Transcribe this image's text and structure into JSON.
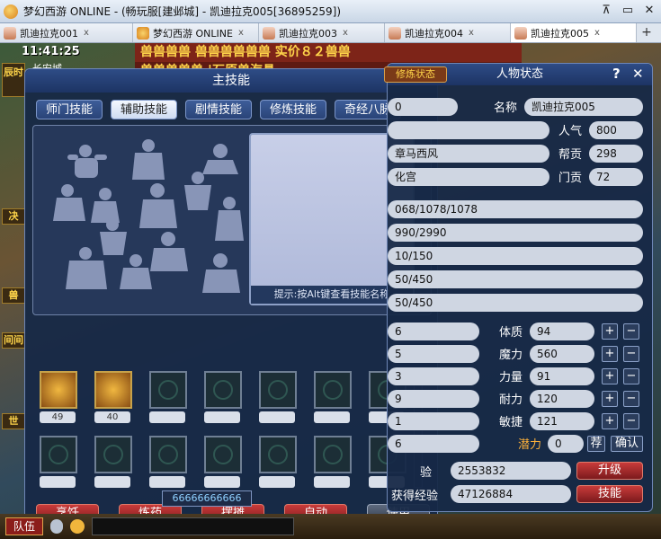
{
  "window": {
    "title": "梦幻西游 ONLINE - (畅玩服[建邺城] - 凯迪拉克005[36895259])",
    "minimize": "▭",
    "pin": "⊼",
    "close": "✕"
  },
  "tabs": [
    {
      "label": "凯迪拉克001"
    },
    {
      "label": "梦幻西游 ONLINE"
    },
    {
      "label": "凯迪拉克003"
    },
    {
      "label": "凯迪拉克004"
    },
    {
      "label": "凯迪拉克005",
      "active": true
    }
  ],
  "tab_add": "+",
  "tab_close": "x",
  "hud": {
    "clock": "11:41:25",
    "city": "长安城",
    "banner_row1": "兽兽兽兽  兽兽兽兽兽兽  实价８２兽兽",
    "banner_row2": "兽兽兽兽兽  |石原兽海悬",
    "side_icons": [
      "辰时",
      "决",
      "兽",
      "间间",
      "世"
    ],
    "team_label": "队伍",
    "number_field": "66666666666"
  },
  "main_panel": {
    "title": "主技能",
    "help": "?",
    "close": "✕",
    "tabs": [
      "师门技能",
      "辅助技能",
      "剧情技能",
      "修炼技能",
      "奇经八脉"
    ],
    "active_tab": "辅助技能",
    "hint": "提示:按Alt键查看技能名称",
    "slots_row1": [
      {
        "filled": true,
        "level": "49"
      },
      {
        "filled": true,
        "level": "40"
      },
      {
        "filled": false,
        "level": ""
      },
      {
        "filled": false,
        "level": ""
      },
      {
        "filled": false,
        "level": ""
      },
      {
        "filled": false,
        "level": ""
      },
      {
        "filled": false,
        "level": ""
      }
    ],
    "slots_row2": [
      {
        "filled": false,
        "level": ""
      },
      {
        "filled": false,
        "level": ""
      },
      {
        "filled": false,
        "level": ""
      },
      {
        "filled": false,
        "level": ""
      },
      {
        "filled": false,
        "level": ""
      },
      {
        "filled": false,
        "level": ""
      },
      {
        "filled": false,
        "level": ""
      }
    ],
    "buttons": [
      "烹饪",
      "炼药",
      "摆摊",
      "自动"
    ],
    "use_button": "使用"
  },
  "status_panel": {
    "title": "人物状态",
    "help": "?",
    "close": "✕",
    "tab_label": "修炼状态",
    "level_value": "0",
    "name_label": "名称",
    "name_value": "凯迪拉克005",
    "popularity_label": "人气",
    "popularity_value": "800",
    "row2_value": "",
    "gang_label": "帮贡",
    "gang_value": "298",
    "title_value": "章马西风",
    "sect_label": "门贡",
    "sect_value": "72",
    "sect_name": "化宫",
    "hp": "068/1078/1078",
    "mp": "990/2990",
    "anger": "10/150",
    "vitality": "50/450",
    "energy": "50/450",
    "attrs": [
      {
        "left": "6",
        "label": "体质",
        "value": "94"
      },
      {
        "left": "5",
        "label": "魔力",
        "value": "560"
      },
      {
        "left": "3",
        "label": "力量",
        "value": "91"
      },
      {
        "left": "9",
        "label": "耐力",
        "value": "120"
      },
      {
        "left": "1",
        "label": "敏捷",
        "value": "121"
      }
    ],
    "plus": "+",
    "minus": "−",
    "row_left_last": "6",
    "potential_label": "潜力",
    "potential_value": "0",
    "save_button": "荐",
    "confirm_button": "确认",
    "exp_label": "验",
    "exp_value": "2553832",
    "gained_exp_label": "获得经验",
    "gained_exp_value": "47126884",
    "upgrade_button": "升级",
    "skill_button": "技能"
  }
}
